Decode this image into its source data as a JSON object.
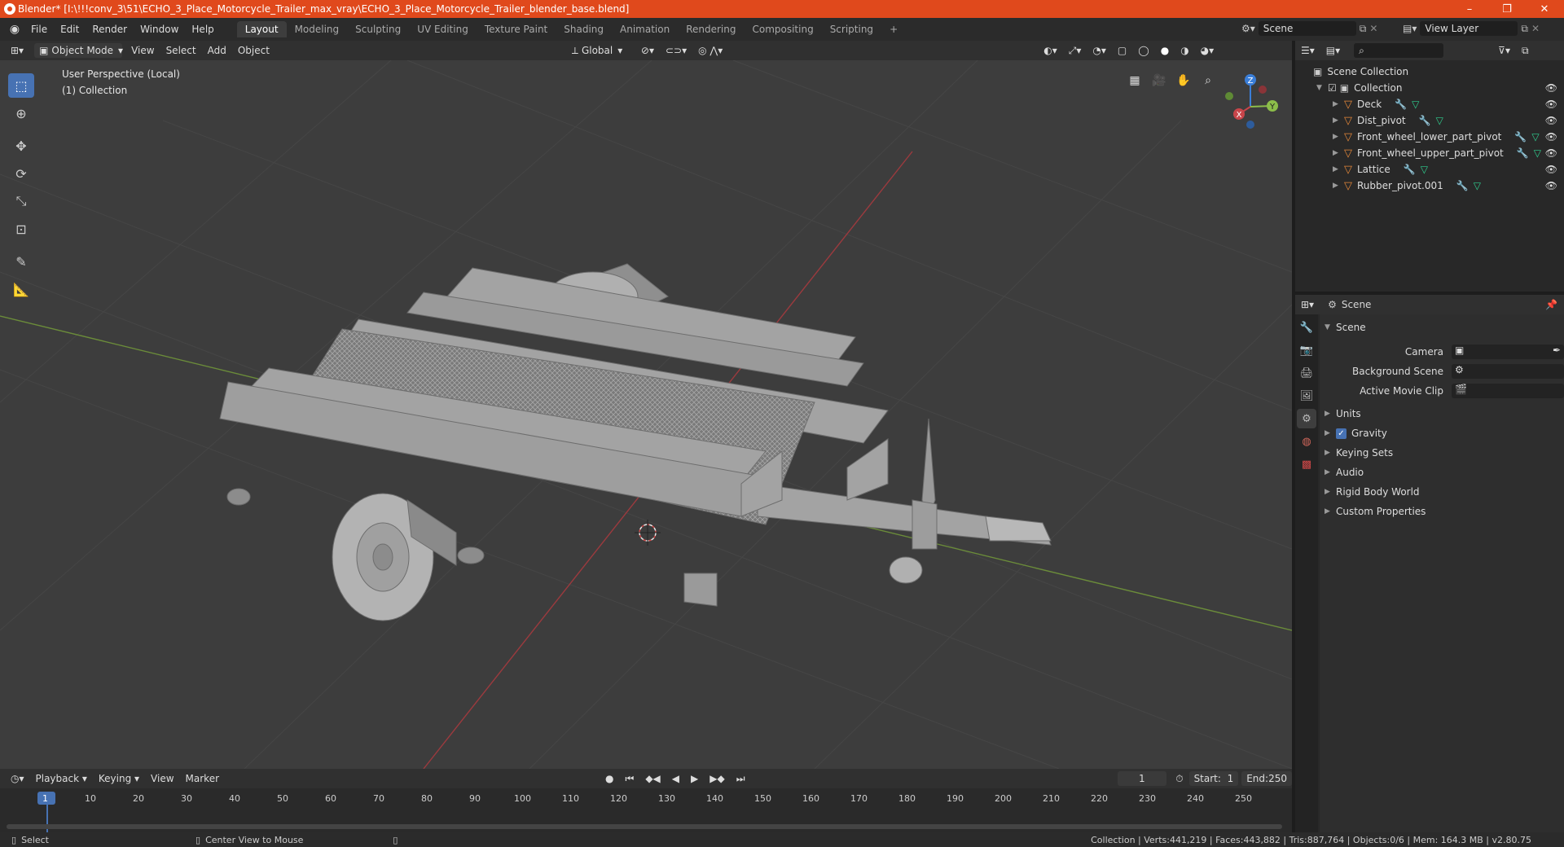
{
  "window": {
    "title": "Blender* [I:\\!!!conv_3\\51\\ECHO_3_Place_Motorcycle_Trailer_max_vray\\ECHO_3_Place_Motorcycle_Trailer_blender_base.blend]",
    "minimize": "–",
    "maximize": "❐",
    "close": "✕"
  },
  "menu": {
    "items": [
      "File",
      "Edit",
      "Render",
      "Window",
      "Help"
    ],
    "tabs": [
      "Layout",
      "Modeling",
      "Sculpting",
      "UV Editing",
      "Texture Paint",
      "Shading",
      "Animation",
      "Rendering",
      "Compositing",
      "Scripting"
    ],
    "active_tab": "Layout",
    "add_tab": "+",
    "scene_label": "Scene",
    "view_layer_label": "View Layer"
  },
  "viewport_header": {
    "mode": "Object Mode",
    "menus": [
      "View",
      "Select",
      "Add",
      "Object"
    ],
    "transform_orientation": "Global"
  },
  "viewport": {
    "perspective_label": "User Perspective (Local)",
    "collection_label": "(1) Collection",
    "gizmo": {
      "x": "X",
      "y": "Y",
      "z": "Z"
    },
    "colors": {
      "x_axis": "#c8454a",
      "y_axis": "#8cbd4a",
      "z_axis": "#3a7ed8",
      "grid_bg": "#3d3d3d",
      "model": "#a3a3a3"
    }
  },
  "outliner": {
    "root": "Scene Collection",
    "collection": "Collection",
    "objects": [
      {
        "name": "Deck"
      },
      {
        "name": "Dist_pivot"
      },
      {
        "name": "Front_wheel_lower_part_pivot"
      },
      {
        "name": "Front_wheel_upper_part_pivot"
      },
      {
        "name": "Lattice"
      },
      {
        "name": "Rubber_pivot.001"
      }
    ]
  },
  "properties": {
    "header": "Scene",
    "panel_title": "Scene",
    "fields": [
      {
        "label": "Camera"
      },
      {
        "label": "Background Scene"
      },
      {
        "label": "Active Movie Clip"
      }
    ],
    "subpanels": [
      {
        "label": "Units",
        "checkbox": false
      },
      {
        "label": "Gravity",
        "checkbox": true
      },
      {
        "label": "Keying Sets",
        "checkbox": false
      },
      {
        "label": "Audio",
        "checkbox": false
      },
      {
        "label": "Rigid Body World",
        "checkbox": false
      },
      {
        "label": "Custom Properties",
        "checkbox": false
      }
    ]
  },
  "timeline": {
    "menus": [
      "Playback",
      "Keying",
      "View",
      "Marker"
    ],
    "current_frame": "1",
    "start_label": "Start:",
    "start_value": "1",
    "end_label": "End:",
    "end_value": "250",
    "ruler": [
      "1",
      "10",
      "20",
      "30",
      "40",
      "50",
      "60",
      "70",
      "80",
      "90",
      "100",
      "110",
      "120",
      "130",
      "140",
      "150",
      "160",
      "170",
      "180",
      "190",
      "200",
      "210",
      "220",
      "230",
      "240",
      "250"
    ]
  },
  "statusbar": {
    "left_action": "Select",
    "middle_action": "Center View to Mouse",
    "stats": "Collection | Verts:441,219 | Faces:443,882 | Tris:887,764 | Objects:0/6 | Mem: 164.3 MB | v2.80.75"
  }
}
